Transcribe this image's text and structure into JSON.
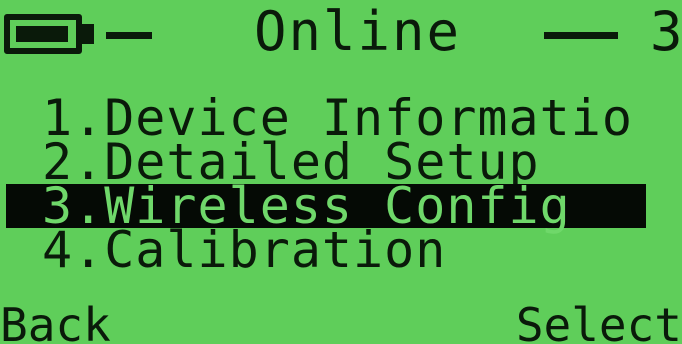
{
  "header": {
    "title": "Online",
    "signal": "3"
  },
  "menu": {
    "items": [
      {
        "label": "1.Device Informatio"
      },
      {
        "label": "2.Detailed Setup"
      },
      {
        "label": "3.Wireless Config"
      },
      {
        "label": "4.Calibration"
      }
    ],
    "selected_index": 2
  },
  "softkeys": {
    "left": "Back",
    "right": "Select"
  },
  "colors": {
    "screen": "#5fce5a",
    "ink": "#0a1a0a"
  }
}
